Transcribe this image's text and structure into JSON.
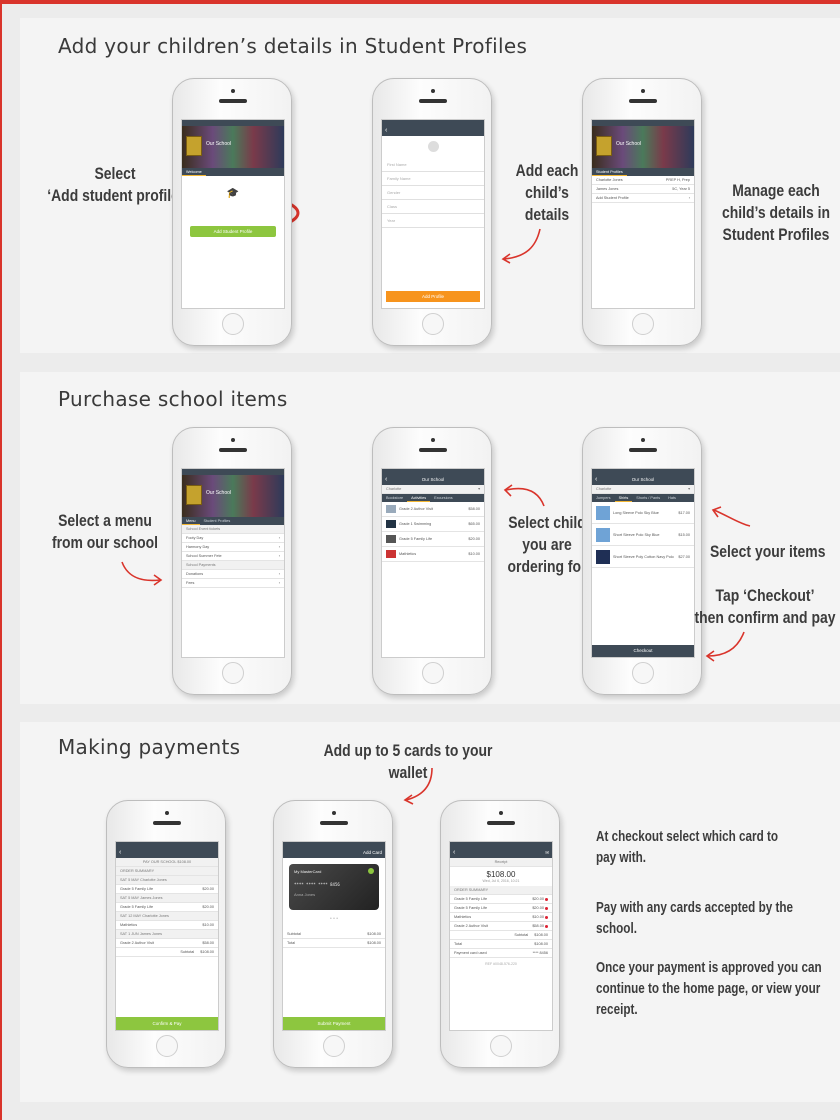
{
  "sections": {
    "profiles": {
      "title": "Add your children’s details in Student Profiles"
    },
    "purchase": {
      "title": "Purchase school items"
    },
    "payments": {
      "title": "Making payments"
    }
  },
  "notes": {
    "select_add": "Select\n‘Add student profile’",
    "add_each": "Add each\nchild’s details",
    "manage_each": "Manage each\nchild’s details in\nStudent Profiles",
    "select_menu": "Select a menu\nfrom our school",
    "select_child": "Select child\nyou are\nordering for",
    "select_items": "Select your items",
    "tap_checkout": "Tap ‘Checkout’\nthen confirm and pay",
    "add_cards": "Add up to 5 cards to your wallet",
    "pay_p1": "At checkout select which card to pay with.",
    "pay_p2": "Pay with any cards accepted by the school.",
    "pay_p3": "Once your payment is approved you can continue to the home page, or view your receipt."
  },
  "screens": {
    "school_name": "Our School",
    "welcome_tab": "Welcome",
    "add_student_profile": "Add Student Profile",
    "student_profiles_tab": "Student Profiles",
    "form_fields": [
      "First Name",
      "Middle Name",
      "Family Name",
      "Gender",
      "Class",
      "Year"
    ],
    "add_profile": "Add Profile",
    "profiles": [
      {
        "name": "Charlotte Jones",
        "detail": "PREP H, Prep"
      },
      {
        "name": "James Jones",
        "detail": "5C, Year 5"
      }
    ],
    "add_student_profile_row": "Add Student Profile",
    "menu_tab": "Menu",
    "menu_rows": [
      "School Event tickets",
      "Footy Day",
      "Harmony Day",
      "School Summer Fete",
      "School Payments",
      "Donations",
      "Fees"
    ],
    "child_name": "Charlotte",
    "activity_tabs": [
      "Bookstore",
      "Activities",
      "Excursions"
    ],
    "activities": [
      {
        "name": "Grade 2 Author Visit",
        "price": "$58.00"
      },
      {
        "name": "Grade 1 Swimming",
        "price": "$65.00"
      },
      {
        "name": "Grade 5 Family Life",
        "price": "$20.00"
      },
      {
        "name": "Mathletics",
        "price": "$10.00"
      }
    ],
    "uniform_tabs": [
      "Jumpers",
      "Shirts",
      "Shorts / Pants",
      "Hats"
    ],
    "uniform_items": [
      {
        "name": "Long Sleeve Polo Sky Blue",
        "price": "$17.00"
      },
      {
        "name": "Short Sleeve Polo Sky Blue",
        "price": "$15.00"
      },
      {
        "name": "Short Sleeve Poly Cotton Navy Polo",
        "price": "$27.00"
      }
    ],
    "checkout": "Checkout",
    "pay_header": "PAY OUR SCHOOL $108.00",
    "order_summary": "ORDER SUMMARY",
    "order_lines": [
      {
        "who": "SAT 5 MAY  Charlotte Jones",
        "item": "Grade 5 Family Life",
        "price": "$20.00"
      },
      {
        "who": "SAT 5 MAY  James Jones",
        "item": "Grade 5 Family Life",
        "price": "$20.00"
      },
      {
        "who": "SAT 12 MAY  Charlotte Jones",
        "item": "Mathletics",
        "price": "$10.00"
      },
      {
        "who": "SAT 1 JUN  James Jones",
        "item": "Grade 2 Author Visit",
        "price": "$58.00"
      }
    ],
    "subtotal_label": "Subtotal",
    "subtotal": "$108.00",
    "confirm_pay": "Confirm & Pay",
    "add_card": "Add Card",
    "card_name": "My MasterCard",
    "card_number": "**** **** **** 8456",
    "card_holder": "Anna Jones",
    "summary_subtotal": "Subtotal",
    "summary_total": "Total",
    "summary_subtotal_value": "$108.00",
    "summary_total_value": "$108.00",
    "submit_payment": "Submit Payment",
    "receipt": "Receipt",
    "receipt_amount": "$108.00",
    "receipt_date": "Wed, Jul 6, 2016, 10:21",
    "total_label": "Total",
    "total_value": "$108.00",
    "payment_card_used": "Payment card used",
    "card_last4": "**** 8456",
    "ref": "REF #0048-576-220"
  },
  "colors": {
    "accent_red": "#d9342b",
    "green": "#8dc63f",
    "orange": "#f7941d",
    "header": "#3e4a56"
  }
}
